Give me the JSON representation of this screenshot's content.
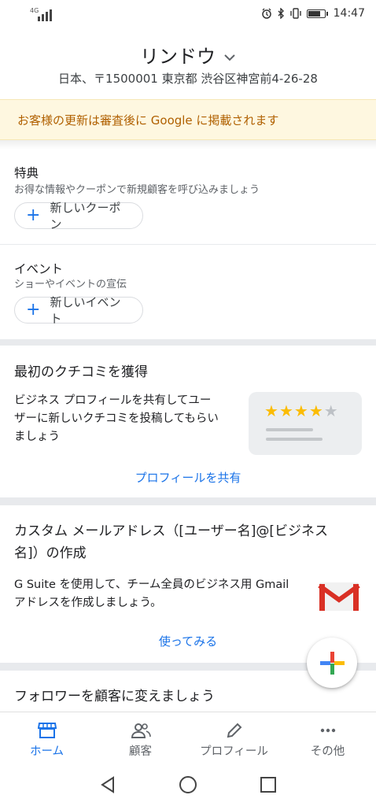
{
  "status_bar": {
    "network": "4G",
    "time": "14:47"
  },
  "header": {
    "business_name": "リンドウ",
    "address": "日本、〒1500001 東京都 渋谷区神宮前4-26-28"
  },
  "notice": {
    "text": "お客様の更新は審査後に Google に掲載されます"
  },
  "offers": {
    "title": "特典",
    "subtitle": "お得な情報やクーポンで新規顧客を呼び込みましょう",
    "button_label": "新しいクーポン"
  },
  "events": {
    "title": "イベント",
    "subtitle": "ショーやイベントの宣伝",
    "button_label": "新しいイベント"
  },
  "review_card": {
    "title": "最初のクチコミを獲得",
    "body_lines": [
      "ビジネス プロフィールを共有してユー",
      "ザーに新しいクチコミを投稿してもらい",
      "ましょう"
    ],
    "stars_filled": 4,
    "stars_total": 5,
    "link_label": "プロフィールを共有"
  },
  "email_card": {
    "title_lines": [
      "カスタム メールアドレス（[ユーザー名]@[ビジネス",
      "名]）の作成"
    ],
    "body_lines": [
      "G Suite を使用して、チーム全員のビジネス用 Gmail",
      "アドレスを作成しましょう。"
    ],
    "link_label": "使ってみる"
  },
  "followers_card": {
    "title": "フォロワーを顧客に変えましょう"
  },
  "bottom_nav": {
    "items": [
      {
        "label": "ホーム",
        "icon": "store-icon"
      },
      {
        "label": "顧客",
        "icon": "people-icon"
      },
      {
        "label": "プロフィール",
        "icon": "pencil-icon"
      },
      {
        "label": "その他",
        "icon": "more-icon"
      }
    ]
  },
  "colors": {
    "accent": "#1a73e8",
    "notice_bg": "#fef7e0",
    "notice_text": "#b06000",
    "star": "#fbbc04"
  }
}
